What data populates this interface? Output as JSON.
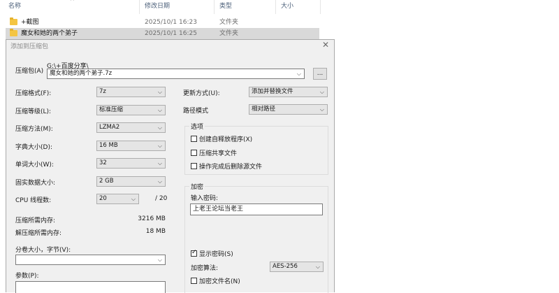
{
  "explorer": {
    "columns": [
      "名称",
      "修改日期",
      "类型",
      "大小"
    ],
    "rows": [
      {
        "name": "+截图",
        "date": "2025/10/1 16:23",
        "type": "文件夹"
      },
      {
        "name": "魔女和她的两个弟子",
        "date": "2025/10/1 16:25",
        "type": "文件夹"
      }
    ]
  },
  "dialog": {
    "title": "添加到压缩包",
    "archive": {
      "label": "压缩包(A)",
      "path": "G:\\+百度分享\\",
      "filename": "魔女和她的两个弟子.7z",
      "browse": "..."
    },
    "left": {
      "format": {
        "label": "压缩格式(F):",
        "value": "7z"
      },
      "level": {
        "label": "压缩等级(L):",
        "value": "标准压缩"
      },
      "method": {
        "label": "压缩方法(M):",
        "value": "LZMA2"
      },
      "dict": {
        "label": "字典大小(D):",
        "value": "16 MB"
      },
      "word": {
        "label": "单词大小(W):",
        "value": "32"
      },
      "solid": {
        "label": "固实数据大小:",
        "value": "2 GB"
      },
      "threads": {
        "label": "CPU 线程数:",
        "value": "20",
        "total": "/ 20"
      },
      "mem_comp": {
        "label": "压缩所需内存:",
        "value": "3216 MB"
      },
      "mem_decomp": {
        "label": "解压缩所需内存:",
        "value": "18 MB"
      },
      "volume": {
        "label": "分卷大小，字节(V):",
        "value": ""
      },
      "params": {
        "label": "参数(P):"
      }
    },
    "right": {
      "update": {
        "label": "更新方式(U):",
        "value": "添加并替换文件"
      },
      "pathmode": {
        "label": "路径模式",
        "value": "相对路径"
      },
      "options": {
        "title": "选项",
        "sfx": "创建自释放程序(X)",
        "shared": "压缩共享文件",
        "delete": "操作完成后删除源文件"
      },
      "encryption": {
        "title": "加密",
        "pwd_label": "输入密码:",
        "pwd_value": "上老王论坛当老王",
        "show_pwd": "显示密码(S)",
        "algo_label": "加密算法:",
        "algo_value": "AES-256",
        "encrypt_names": "加密文件名(N)"
      }
    }
  }
}
